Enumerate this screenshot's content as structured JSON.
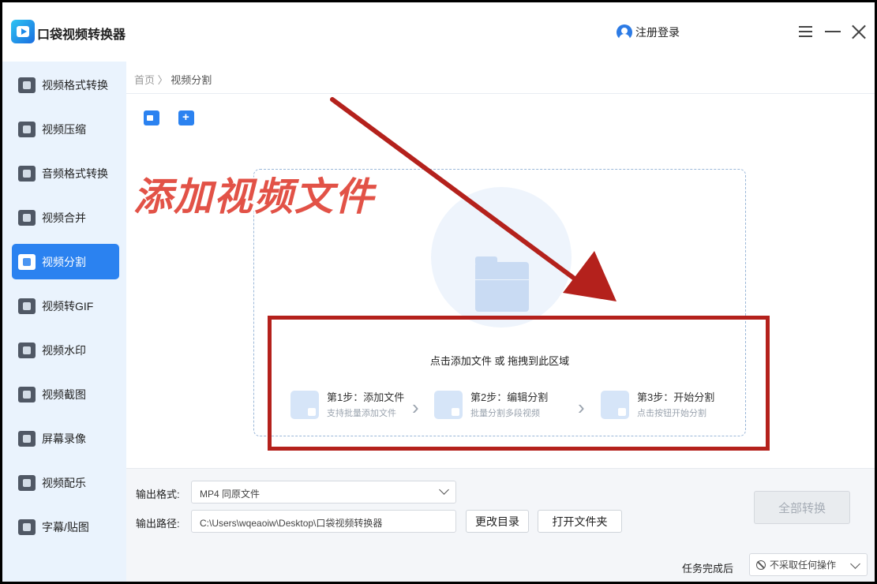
{
  "app": {
    "title": "口袋视频转换器",
    "login_label": "注册登录"
  },
  "sidebar": {
    "items": [
      {
        "label": "视频格式转换",
        "icon": "format-convert-icon"
      },
      {
        "label": "视频压缩",
        "icon": "compress-icon"
      },
      {
        "label": "音频格式转换",
        "icon": "audio-convert-icon"
      },
      {
        "label": "视频合并",
        "icon": "merge-icon"
      },
      {
        "label": "视频分割",
        "icon": "split-icon",
        "active": true
      },
      {
        "label": "视频转GIF",
        "icon": "gif-icon"
      },
      {
        "label": "视频水印",
        "icon": "watermark-icon"
      },
      {
        "label": "视频截图",
        "icon": "screenshot-icon"
      },
      {
        "label": "屏幕录像",
        "icon": "screen-record-icon"
      },
      {
        "label": "视频配乐",
        "icon": "music-icon"
      },
      {
        "label": "字幕/贴图",
        "icon": "subtitle-icon"
      }
    ]
  },
  "breadcrumb": {
    "home": "首页",
    "separator": "〉",
    "current": "视频分割"
  },
  "dropzone": {
    "hint": "点击添加文件 或 拖拽到此区域",
    "steps": [
      {
        "title": "第1步：添加文件",
        "sub": "支持批量添加文件"
      },
      {
        "title": "第2步：编辑分割",
        "sub": "批量分割多段视频"
      },
      {
        "title": "第3步：开始分割",
        "sub": "点击按钮开始分割"
      }
    ]
  },
  "annotation": {
    "text": "添加视频文件",
    "color": "#b4211c"
  },
  "output": {
    "format_label": "输出格式:",
    "format_value": "MP4  同原文件",
    "path_label": "输出路径:",
    "path_value": "C:\\Users\\wqeaoiw\\Desktop\\口袋视频转换器",
    "change_dir_label": "更改目录",
    "open_folder_label": "打开文件夹",
    "convert_all_label": "全部转换",
    "after_label": "任务完成后",
    "after_value": "不采取任何操作"
  },
  "colors": {
    "accent": "#2b82f0",
    "sidebar_bg": "#eaf3fd"
  }
}
